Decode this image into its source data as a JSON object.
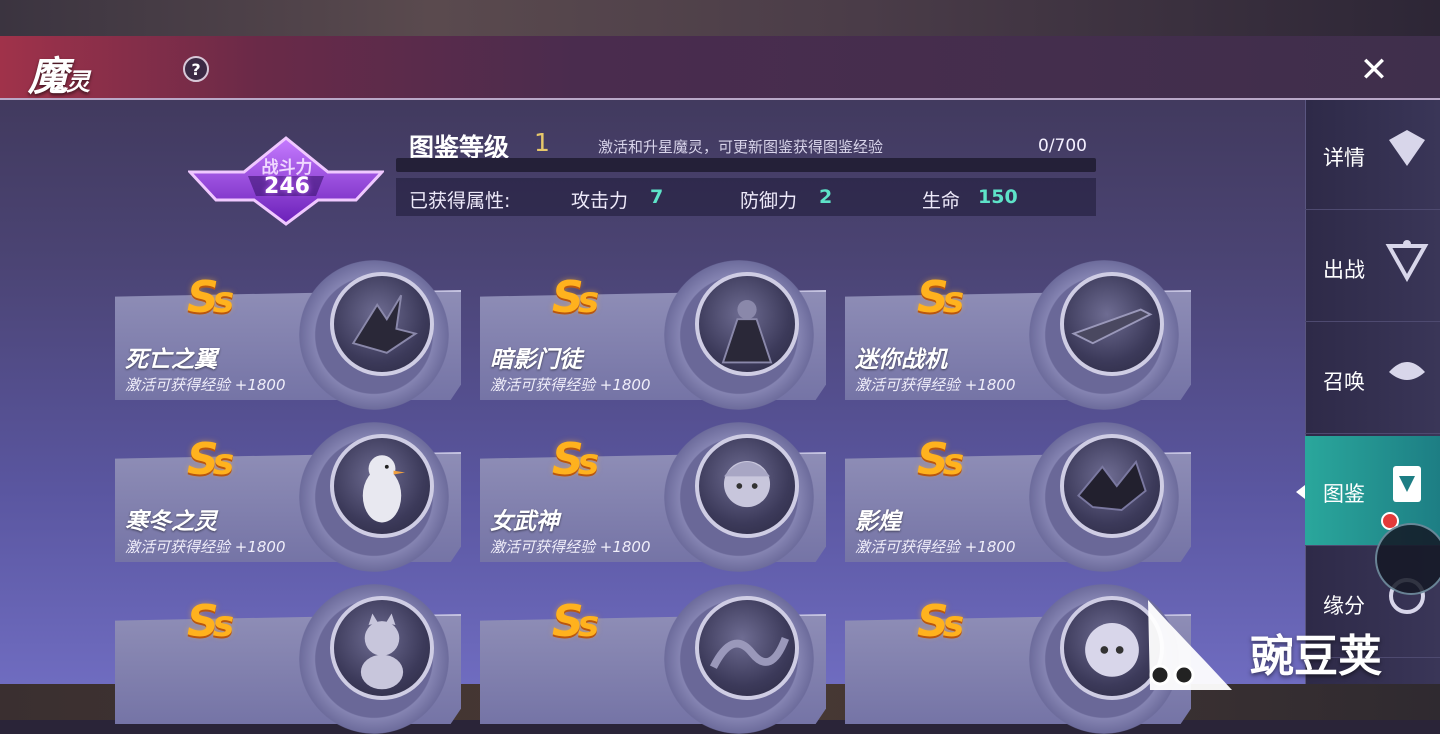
{
  "header": {
    "title_main": "魔",
    "title_small": "灵",
    "help_symbol": "?",
    "close_symbol": "✕"
  },
  "power": {
    "label": "战斗力",
    "value": "246"
  },
  "codex": {
    "level_label": "图鉴等级",
    "level_value": "1",
    "description": "激活和升星魔灵，可更新图鉴获得图鉴经验",
    "progress": "0/700",
    "progress_fraction": 0,
    "attr_label": "已获得属性:",
    "attrs": [
      {
        "name": "攻击力",
        "value": "7"
      },
      {
        "name": "防御力",
        "value": "2"
      },
      {
        "name": "生命",
        "value": "150"
      }
    ]
  },
  "cards": [
    {
      "rank": "S",
      "rank2": "s",
      "name": "死亡之翼",
      "exp": "激活可获得经验 +1800",
      "portrait": "dragon-icon"
    },
    {
      "rank": "S",
      "rank2": "s",
      "name": "暗影门徒",
      "exp": "激活可获得经验 +1800",
      "portrait": "caped-figure-icon"
    },
    {
      "rank": "S",
      "rank2": "s",
      "name": "迷你战机",
      "exp": "激活可获得经验 +1800",
      "portrait": "fighter-jet-icon"
    },
    {
      "rank": "S",
      "rank2": "s",
      "name": "寒冬之灵",
      "exp": "激活可获得经验 +1800",
      "portrait": "penguin-icon"
    },
    {
      "rank": "S",
      "rank2": "s",
      "name": "女武神",
      "exp": "激活可获得经验 +1800",
      "portrait": "valkyrie-icon"
    },
    {
      "rank": "S",
      "rank2": "s",
      "name": "影煌",
      "exp": "激活可获得经验 +1800",
      "portrait": "shadow-dragon-icon"
    },
    {
      "rank": "S",
      "rank2": "s",
      "name": "",
      "exp": "",
      "portrait": "lucky-cat-icon"
    },
    {
      "rank": "S",
      "rank2": "s",
      "name": "",
      "exp": "",
      "portrait": "serpent-dragon-icon"
    },
    {
      "rank": "S",
      "rank2": "s",
      "name": "",
      "exp": "",
      "portrait": "fluffy-creature-icon"
    }
  ],
  "sidebar": {
    "items": [
      {
        "label": "详情",
        "icon": "detail-crest-icon",
        "active": false
      },
      {
        "label": "出战",
        "icon": "battle-crest-icon",
        "active": false
      },
      {
        "label": "召唤",
        "icon": "summon-crest-icon",
        "active": false
      },
      {
        "label": "图鉴",
        "icon": "codex-book-icon",
        "active": true
      },
      {
        "label": "缘分",
        "icon": "bond-crest-icon",
        "active": false
      }
    ]
  },
  "watermark": {
    "text": "豌豆荚"
  },
  "colors": {
    "accent_teal": "#2aa79c",
    "rank_gold": "#ffb21e",
    "attr_value": "#5ee3c8",
    "title_red": "#a0324a"
  }
}
